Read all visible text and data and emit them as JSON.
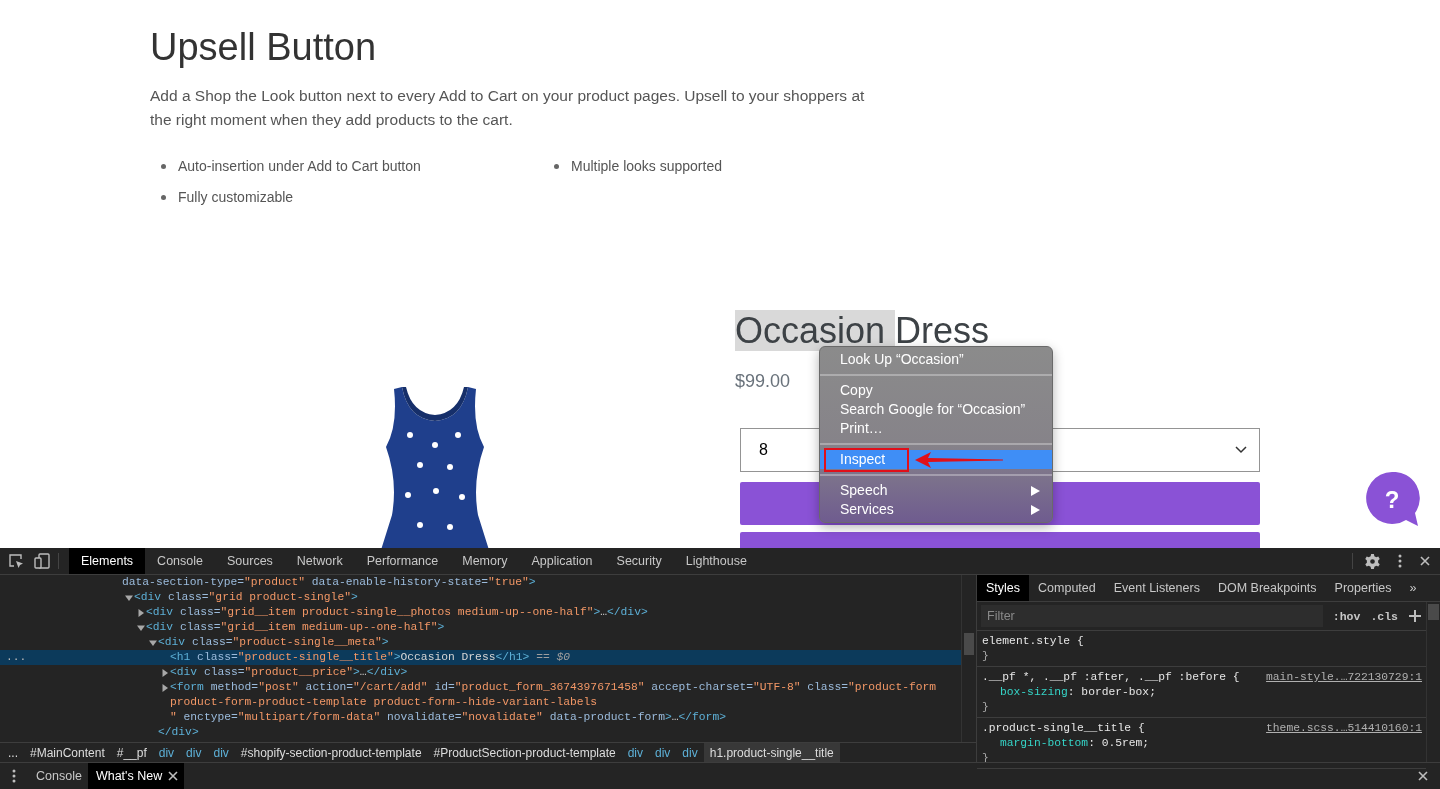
{
  "page": {
    "title": "Upsell Button",
    "description_lines": [
      "Add a Shop the Look button next to every Add to Cart on your product pages. Upsell to your shoppers at",
      "the right moment when they add products to the cart."
    ],
    "features": [
      "Auto-insertion under Add to Cart button",
      "Multiple looks supported",
      "Fully customizable"
    ],
    "product": {
      "title_parts": [
        {
          "text": "Occasion",
          "selected": true
        },
        {
          "text": "Dress",
          "selected": false
        }
      ],
      "price": "$99.00",
      "quantity": {
        "value": "8"
      },
      "buttons": [
        {
          "kind": "button"
        },
        {
          "kind": "button"
        }
      ]
    },
    "help_button": {
      "label": "?"
    }
  },
  "context_menu": {
    "items": [
      {
        "kind": "item",
        "label": "Look Up “Occasion”",
        "selected": false,
        "submenu": false,
        "annotated": false
      },
      {
        "kind": "separator"
      },
      {
        "kind": "item",
        "label": "Copy",
        "selected": false,
        "submenu": false,
        "annotated": false
      },
      {
        "kind": "item",
        "label": "Search Google for “Occasion”",
        "selected": false,
        "submenu": false,
        "annotated": false
      },
      {
        "kind": "item",
        "label": "Print…",
        "selected": false,
        "submenu": false,
        "annotated": false
      },
      {
        "kind": "separator"
      },
      {
        "kind": "item",
        "label": "Inspect",
        "selected": true,
        "submenu": false,
        "annotated": true
      },
      {
        "kind": "separator"
      },
      {
        "kind": "item",
        "label": "Speech",
        "selected": false,
        "submenu": true,
        "annotated": false
      },
      {
        "kind": "item",
        "label": "Services",
        "selected": false,
        "submenu": true,
        "annotated": false
      }
    ]
  },
  "devtools": {
    "tabs": [
      {
        "label": "Elements",
        "selected": true
      },
      {
        "label": "Console",
        "selected": false
      },
      {
        "label": "Sources",
        "selected": false
      },
      {
        "label": "Network",
        "selected": false
      },
      {
        "label": "Performance",
        "selected": false
      },
      {
        "label": "Memory",
        "selected": false
      },
      {
        "label": "Application",
        "selected": false
      },
      {
        "label": "Security",
        "selected": false
      },
      {
        "label": "Lighthouse",
        "selected": false
      }
    ],
    "dom_tree": [
      {
        "selected": false,
        "lines": [
          [
            {
              "kind": "attr",
              "text": "data-section-type="
            },
            {
              "kind": "value",
              "text": "\"product\""
            },
            {
              "kind": "attr",
              "text": " data-enable-history-state="
            },
            {
              "kind": "value",
              "text": "\"true\""
            },
            {
              "kind": "tag",
              "text": ">"
            }
          ]
        ],
        "children": [
          {
            "selected": false,
            "expanded": true,
            "lines": [
              [
                {
                  "kind": "tag",
                  "text": "<div"
                },
                {
                  "kind": "attr",
                  "text": " class="
                },
                {
                  "kind": "value",
                  "text": "\"grid product-single\""
                },
                {
                  "kind": "tag",
                  "text": ">"
                }
              ]
            ],
            "children": [
              {
                "selected": false,
                "expanded": false,
                "lines": [
                  [
                    {
                      "kind": "tag",
                      "text": "<div"
                    },
                    {
                      "kind": "attr",
                      "text": " class="
                    },
                    {
                      "kind": "value",
                      "text": "\"grid__item product-single__photos medium-up--one-half\""
                    },
                    {
                      "kind": "tag",
                      "text": ">"
                    },
                    {
                      "kind": "text",
                      "text": "…"
                    },
                    {
                      "kind": "tag",
                      "text": "</div>"
                    }
                  ]
                ]
              },
              {
                "selected": false,
                "expanded": true,
                "lines": [
                  [
                    {
                      "kind": "tag",
                      "text": "<div"
                    },
                    {
                      "kind": "attr",
                      "text": " class="
                    },
                    {
                      "kind": "value",
                      "text": "\"grid__item medium-up--one-half\""
                    },
                    {
                      "kind": "tag",
                      "text": ">"
                    }
                  ]
                ],
                "children": [
                  {
                    "selected": false,
                    "expanded": true,
                    "lines": [
                      [
                        {
                          "kind": "tag",
                          "text": "<div"
                        },
                        {
                          "kind": "attr",
                          "text": " class="
                        },
                        {
                          "kind": "value",
                          "text": "\"product-single__meta\""
                        },
                        {
                          "kind": "tag",
                          "text": ">"
                        }
                      ]
                    ],
                    "close": [
                      {
                        "kind": "tag",
                        "text": "</div>"
                      }
                    ],
                    "children": [
                      {
                        "selected": true,
                        "gutter": "...",
                        "lines": [
                          [
                            {
                              "kind": "tag",
                              "text": "<h1"
                            },
                            {
                              "kind": "attr",
                              "text": " class="
                            },
                            {
                              "kind": "value",
                              "text": "\"product-single__title\""
                            },
                            {
                              "kind": "tag",
                              "text": ">"
                            },
                            {
                              "kind": "text",
                              "text": "Occasion Dress"
                            },
                            {
                              "kind": "tag",
                              "text": "</h1>"
                            },
                            {
                              "kind": "note",
                              "text": " == "
                            },
                            {
                              "kind": "note_italic",
                              "text": "$0"
                            }
                          ]
                        ]
                      },
                      {
                        "selected": false,
                        "expanded": false,
                        "lines": [
                          [
                            {
                              "kind": "tag",
                              "text": "<div"
                            },
                            {
                              "kind": "attr",
                              "text": " class="
                            },
                            {
                              "kind": "value",
                              "text": "\"product__price\""
                            },
                            {
                              "kind": "tag",
                              "text": ">"
                            },
                            {
                              "kind": "text",
                              "text": "…"
                            },
                            {
                              "kind": "tag",
                              "text": "</div>"
                            }
                          ]
                        ]
                      },
                      {
                        "selected": false,
                        "expanded": false,
                        "lines": [
                          [
                            {
                              "kind": "tag",
                              "text": "<form"
                            },
                            {
                              "kind": "attr",
                              "text": " method="
                            },
                            {
                              "kind": "value",
                              "text": "\"post\""
                            },
                            {
                              "kind": "attr",
                              "text": " action="
                            },
                            {
                              "kind": "value",
                              "text": "\"/cart/add\""
                            },
                            {
                              "kind": "attr",
                              "text": " id="
                            },
                            {
                              "kind": "value",
                              "text": "\"product_form_3674397671458\""
                            },
                            {
                              "kind": "attr",
                              "text": " accept-charset="
                            },
                            {
                              "kind": "value",
                              "text": "\"UTF-8\""
                            },
                            {
                              "kind": "attr",
                              "text": " class="
                            },
                            {
                              "kind": "value",
                              "text": "\"product-form"
                            }
                          ],
                          [
                            {
                              "kind": "value",
                              "text": "product-form-product-template product-form--hide-variant-labels"
                            }
                          ],
                          [
                            {
                              "kind": "value",
                              "text": "\""
                            },
                            {
                              "kind": "attr",
                              "text": " enctype="
                            },
                            {
                              "kind": "value",
                              "text": "\"multipart/form-data\""
                            },
                            {
                              "kind": "attr",
                              "text": " novalidate="
                            },
                            {
                              "kind": "value",
                              "text": "\"novalidate\""
                            },
                            {
                              "kind": "attr",
                              "text": " data-product-form"
                            },
                            {
                              "kind": "tag",
                              "text": ">"
                            },
                            {
                              "kind": "text",
                              "text": "…"
                            },
                            {
                              "kind": "tag",
                              "text": "</form>"
                            }
                          ]
                        ]
                      }
                    ]
                  }
                ]
              }
            ]
          }
        ]
      }
    ],
    "breadcrumbs": [
      {
        "kind": "more",
        "label": "...",
        "selected": false
      },
      {
        "kind": "id",
        "label": "#MainContent",
        "selected": false
      },
      {
        "kind": "id",
        "label": "#__pf",
        "selected": false
      },
      {
        "kind": "tag",
        "label": "div",
        "selected": false
      },
      {
        "kind": "tag",
        "label": "div",
        "selected": false
      },
      {
        "kind": "tag",
        "label": "div",
        "selected": false
      },
      {
        "kind": "id",
        "label": "#shopify-section-product-template",
        "selected": false
      },
      {
        "kind": "id",
        "label": "#ProductSection-product-template",
        "selected": false
      },
      {
        "kind": "tag",
        "label": "div",
        "selected": false
      },
      {
        "kind": "tag",
        "label": "div",
        "selected": false
      },
      {
        "kind": "tag",
        "label": "div",
        "selected": false
      },
      {
        "kind": "id",
        "label": "h1.product-single__title",
        "selected": true
      }
    ],
    "sidebar_tabs": [
      {
        "label": "Styles",
        "selected": true
      },
      {
        "label": "Computed",
        "selected": false
      },
      {
        "label": "Event Listeners",
        "selected": false
      },
      {
        "label": "DOM Breakpoints",
        "selected": false
      },
      {
        "label": "Properties",
        "selected": false
      }
    ],
    "sidebar_overflow": "»",
    "filter": {
      "placeholder": "Filter"
    },
    "filter_buttons": [
      ":hov",
      ".cls"
    ],
    "rules": [
      {
        "selector": "element.style {",
        "end": "}"
      },
      {
        "selector": ".__pf *, .__pf :after, .__pf :before {",
        "source": "main-style.…722130729:1",
        "declarations": [
          {
            "property": "box-sizing",
            "rest": ": border-box;"
          }
        ],
        "end": "}"
      },
      {
        "selector": ".product-single__title {",
        "source": "theme.scss.…514410160:1",
        "declarations": [
          {
            "property": "margin-bottom",
            "rest": ": 0.5rem;"
          }
        ],
        "end": "}"
      }
    ],
    "drawer_tabs": [
      {
        "label": "Console",
        "selected": false,
        "closable": false
      },
      {
        "label": "What's New",
        "selected": true,
        "closable": true
      }
    ]
  }
}
